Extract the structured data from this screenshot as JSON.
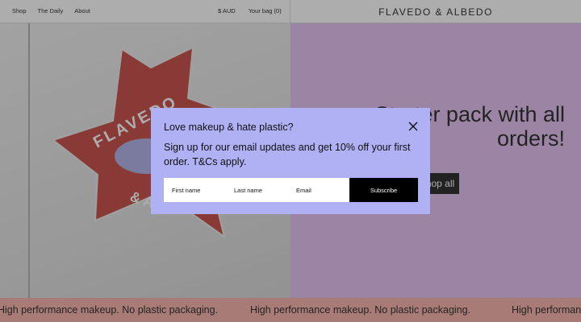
{
  "header": {
    "nav": [
      "Shop",
      "The Daily",
      "About"
    ],
    "currency": "$ AUD",
    "bag": "Your bag (0)",
    "brand": "FLAVEDO & ALBEDO"
  },
  "hero": {
    "title": "Starter pack with all orders!",
    "cta_label": "Shop all",
    "sticker_text": "FLAVEDO & ALBEDO"
  },
  "marquee": {
    "text": "High performance makeup. No plastic packaging."
  },
  "modal": {
    "title": "Love makeup & hate plastic?",
    "body": "Sign up for our email updates and get 10% off your first order. T&Cs apply.",
    "first_name_placeholder": "First name",
    "last_name_placeholder": "Last name",
    "email_placeholder": "Email",
    "subscribe_label": "Subscribe"
  },
  "colors": {
    "hero_accent": "#e2b9f0",
    "marquee_bg": "#f7aaa0",
    "modal_bg": "#b0b0f4",
    "star": "#c23a32"
  },
  "icons": {
    "close": "close-icon"
  }
}
